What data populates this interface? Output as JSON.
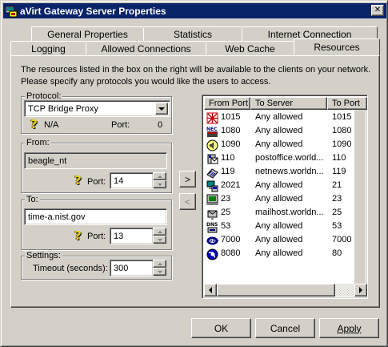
{
  "window": {
    "title": "aVirt Gateway Server Properties",
    "close_glyph": "✕"
  },
  "tabs_back": [
    {
      "label": "General Properties"
    },
    {
      "label": "Statistics"
    },
    {
      "label": "Internet Connection"
    }
  ],
  "tabs_front": [
    {
      "label": "Logging"
    },
    {
      "label": "Allowed Connections"
    },
    {
      "label": "Web Cache"
    },
    {
      "label": "Resources"
    }
  ],
  "active_tab": "Resources",
  "description": "The resources listed in the box on the right will be available to the clients on your network. Please specify any protocols you would like the users to access.",
  "protocol": {
    "group_label": "Protocol:",
    "value": "TCP Bridge Proxy",
    "na_label": "N/A",
    "port_label": "Port:",
    "port_value": "0"
  },
  "from": {
    "group_label": "From:",
    "host_value": "beagle_nt",
    "port_label": "Port:",
    "port_value": "14"
  },
  "to": {
    "group_label": "To:",
    "host_value": "time-a.nist.gov",
    "port_label": "Port:",
    "port_value": "13"
  },
  "settings": {
    "group_label": "Settings:",
    "timeout_label": "Timeout (seconds):",
    "timeout_value": "300"
  },
  "transfer": {
    "add_glyph": ">",
    "remove_glyph": "<"
  },
  "resources": {
    "columns": [
      "From Port",
      "To Server",
      "To Port"
    ],
    "rows": [
      {
        "from_port": "1015",
        "to_server": "Any allowed",
        "to_port": "1015",
        "icon": "red-grid-icon"
      },
      {
        "from_port": "1080",
        "to_server": "Any allowed",
        "to_port": "1080",
        "icon": "nec-icon"
      },
      {
        "from_port": "1090",
        "to_server": "Any allowed",
        "to_port": "1090",
        "icon": "sound-icon"
      },
      {
        "from_port": "110",
        "to_server": "postoffice.world...",
        "to_port": "110",
        "icon": "mail-icon"
      },
      {
        "from_port": "119",
        "to_server": "netnews.worldn...",
        "to_port": "119",
        "icon": "news-icon"
      },
      {
        "from_port": "2021",
        "to_server": "Any allowed",
        "to_port": "21",
        "icon": "network-computer-icon"
      },
      {
        "from_port": "23",
        "to_server": "Any allowed",
        "to_port": "23",
        "icon": "terminal-icon"
      },
      {
        "from_port": "25",
        "to_server": "mailhost.worldn...",
        "to_port": "25",
        "icon": "mailbox-icon"
      },
      {
        "from_port": "53",
        "to_server": "Any allowed",
        "to_port": "53",
        "icon": "dns-icon"
      },
      {
        "from_port": "7000",
        "to_server": "Any allowed",
        "to_port": "7000",
        "icon": "video-icon"
      },
      {
        "from_port": "8080",
        "to_server": "Any allowed",
        "to_port": "80",
        "icon": "web-globe-icon"
      }
    ]
  },
  "buttons": {
    "ok": "OK",
    "cancel": "Cancel",
    "apply": "Apply"
  },
  "colors": {
    "face": "#d4d0c8",
    "titlebar": "#0a246a",
    "help_icon": "#e8d000"
  }
}
